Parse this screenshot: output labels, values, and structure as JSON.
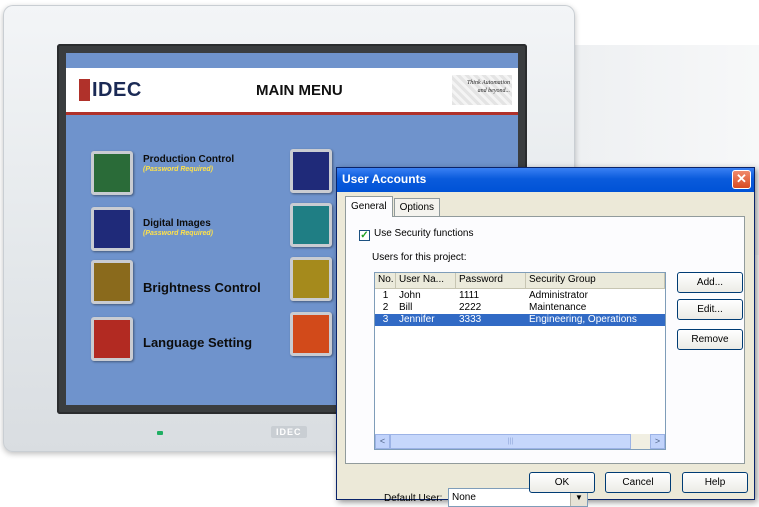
{
  "hmi": {
    "logo_text": "IDEC",
    "title": "MAIN MENU",
    "tagline_line1": "Think Automation",
    "tagline_line2": "and beyond...",
    "device_brand": "IDEC",
    "buttons_left": [
      {
        "label": "Production Control",
        "note": "(Password Required)",
        "color": "#2a6b38"
      },
      {
        "label": "Digital Images",
        "note": "(Password Required)",
        "color": "#1f2a79"
      },
      {
        "label": "Brightness Control",
        "note": "",
        "color": "#8a6a1c"
      },
      {
        "label": "Language Setting",
        "note": "",
        "color": "#b22a22"
      }
    ],
    "buttons_right": [
      {
        "color": "#1f2a79"
      },
      {
        "color": "#1f7e84"
      },
      {
        "color": "#a58a1c"
      },
      {
        "color": "#d24a1a"
      }
    ],
    "screen_bg": "#6f93cc"
  },
  "dialog": {
    "title": "User Accounts",
    "close_glyph": "✕",
    "tabs": [
      "General",
      "Options"
    ],
    "active_tab": "General",
    "security_checkbox": {
      "label": "Use Security functions",
      "checked": true
    },
    "users_label": "Users for this project:",
    "columns": [
      "No.",
      "User Na...",
      "Password",
      "Security Group"
    ],
    "rows": [
      {
        "no": "1",
        "user": "John",
        "password": "1111",
        "group": "Administrator",
        "selected": false
      },
      {
        "no": "2",
        "user": "Bill",
        "password": "2222",
        "group": "Maintenance",
        "selected": false
      },
      {
        "no": "3",
        "user": "Jennifer",
        "password": "3333",
        "group": "Engineering, Operations",
        "selected": true
      }
    ],
    "side_buttons": {
      "add": "Add...",
      "edit": "Edit...",
      "remove": "Remove"
    },
    "default_user_label": "Default User:",
    "default_user_value": "None",
    "footer_buttons": {
      "ok": "OK",
      "cancel": "Cancel",
      "help": "Help"
    },
    "scroll_left": "<",
    "scroll_right": ">",
    "scroll_grip": "|||",
    "dropdown_arrow": "▼",
    "check_glyph": "✓"
  }
}
